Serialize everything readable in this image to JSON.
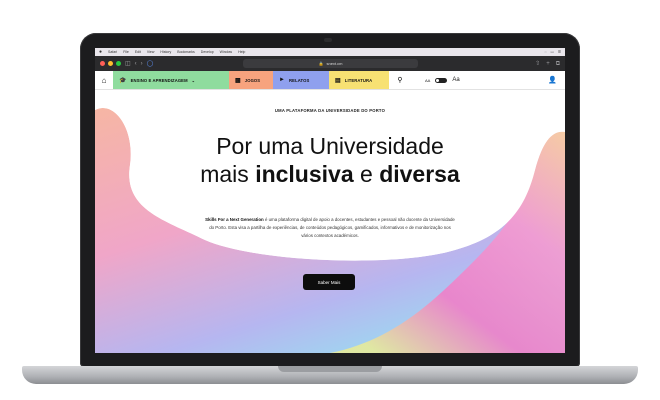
{
  "menubar": {
    "items": [
      "Safari",
      "File",
      "Edit",
      "View",
      "History",
      "Bookmarks",
      "Develop",
      "Window",
      "Help"
    ]
  },
  "browser": {
    "url": "snext.cm"
  },
  "nav": {
    "tabs": [
      {
        "label": "ENSINO E APRENDIZAGEM",
        "color": "#8fdc9e",
        "icon": "graduation-cap-icon"
      },
      {
        "label": "JOGOS",
        "color": "#f7a37e",
        "icon": "gamepad-icon"
      },
      {
        "label": "RELATOS",
        "color": "#8fa0ee",
        "icon": "megaphone-icon"
      },
      {
        "label": "LITERATURA",
        "color": "#f7e173",
        "icon": "book-icon"
      }
    ],
    "font_size_control": "AA",
    "text_size_label": "Aa"
  },
  "hero": {
    "eyebrow": "UMA PLATAFORMA DA UNIVERSIDADE DO PORTO",
    "headline_line1": "Por uma Universidade",
    "headline_mais": "mais ",
    "headline_inclusiva": "inclusiva",
    "headline_e": " e ",
    "headline_diversa": "diversa",
    "intro_bold": "Skills For a Next Generation",
    "intro_rest": " é uma plataforma digital de apoio a docentes, estudantes e pessoal não docente da Universidade do Porto. Esta visa a partilha de experiências, de conteúdos pedagógicos, gamificados, informativos e de monitorização nos vários contextos académicos.",
    "cta_label": "Saber Mais"
  }
}
